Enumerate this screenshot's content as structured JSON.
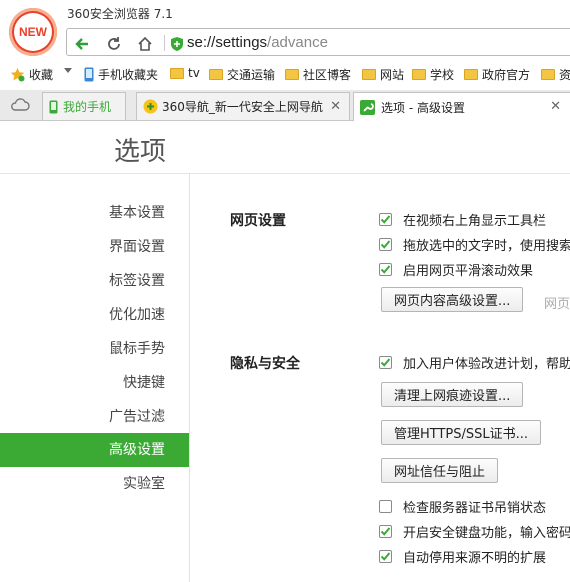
{
  "app": {
    "title": "360安全浏览器 7.1",
    "logo_text": "NEW"
  },
  "address": {
    "host": "se://settings",
    "path": "/advance"
  },
  "bookmarks": [
    {
      "label": "收藏",
      "icon": "star-icon"
    },
    {
      "label": "手机收藏夹",
      "icon": "phone-icon"
    },
    {
      "label": "tv",
      "icon": "folder-icon"
    },
    {
      "label": "交通运输",
      "icon": "folder-icon"
    },
    {
      "label": "社区博客",
      "icon": "folder-icon"
    },
    {
      "label": "网站",
      "icon": "folder-icon"
    },
    {
      "label": "学校",
      "icon": "folder-icon"
    },
    {
      "label": "政府官方",
      "icon": "folder-icon"
    },
    {
      "label": "资",
      "icon": "folder-icon"
    }
  ],
  "tabs": [
    {
      "label": "我的手机"
    },
    {
      "label": "360导航_新一代安全上网导航"
    },
    {
      "label": "选项 - 高级设置"
    }
  ],
  "page": {
    "title": "选项"
  },
  "sidebar": {
    "items": [
      {
        "label": "基本设置"
      },
      {
        "label": "界面设置"
      },
      {
        "label": "标签设置"
      },
      {
        "label": "优化加速"
      },
      {
        "label": "鼠标手势"
      },
      {
        "label": "快捷键"
      },
      {
        "label": "广告过滤"
      },
      {
        "label": "高级设置"
      },
      {
        "label": "实验室"
      }
    ],
    "active_index": 7
  },
  "webpage_section": {
    "title": "网页设置",
    "options": [
      {
        "label": "在视频右上角显示工具栏",
        "checked": true
      },
      {
        "label": "拖放选中的文字时，使用搜索",
        "checked": true
      },
      {
        "label": "启用网页平滑滚动效果",
        "checked": true
      }
    ],
    "button": "网页内容高级设置...",
    "hint": "网页"
  },
  "privacy_section": {
    "title": "隐私与安全",
    "option_top": {
      "label": "加入用户体验改进计划，帮助",
      "checked": true
    },
    "buttons": [
      "清理上网痕迹设置...",
      "管理HTTPS/SSL证书...",
      "网址信任与阻止"
    ],
    "options": [
      {
        "label": "检查服务器证书吊销状态",
        "checked": false
      },
      {
        "label": "开启安全键盘功能，输入密码",
        "checked": true
      },
      {
        "label": "自动停用来源不明的扩展",
        "checked": true
      }
    ]
  },
  "colors": {
    "accent": "#3aaa35",
    "logo": "#e8412c"
  }
}
